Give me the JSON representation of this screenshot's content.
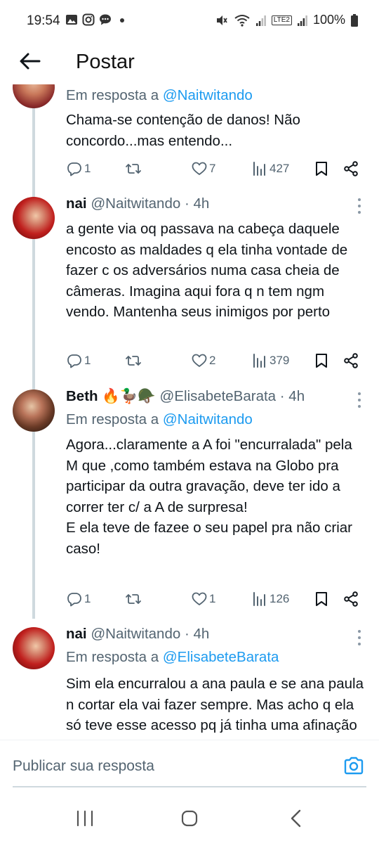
{
  "status_bar": {
    "time": "19:54",
    "battery": "100%",
    "network_label": "LTE2",
    "left_icons": [
      "gallery-icon",
      "instagram-icon",
      "chat-bubble-icon",
      "dot-icon"
    ],
    "right_icons": [
      "mute-icon",
      "wifi-icon",
      "signal-icon",
      "volte-icon",
      "signal-icon",
      "battery-icon"
    ]
  },
  "header": {
    "title": "Postar"
  },
  "posts": [
    {
      "reply_prefix": "Em resposta a",
      "reply_to": "@Naitwitando",
      "text": "Chama-se contenção de danos! Não concordo...mas entendo...",
      "replies": "1",
      "reposts": "",
      "likes": "7",
      "views": "427"
    },
    {
      "name": "nai",
      "meta": "@Naitwitando · 4h",
      "text": "a gente via oq passava na cabeça daquele encosto as maldades q ela tinha vontade de fazer c os adversários numa casa cheia de câmeras. Imagina aqui fora q n tem ngm vendo. Mantenha seus inimigos por perto",
      "replies": "1",
      "reposts": "",
      "likes": "2",
      "views": "379"
    },
    {
      "name": "Beth 🔥🦆🪖",
      "meta": "@ElisabeteBarata · 4h",
      "reply_prefix": "Em resposta a",
      "reply_to": "@Naitwitando",
      "text": "Agora...claramente a A foi \"encurralada\" pela M que ,como também estava na Globo pra participar da outra gravação, deve ter ido a correr ter c/ a A de surpresa!\nE ela teve de fazee o seu papel pra não criar caso!",
      "replies": "1",
      "reposts": "",
      "likes": "1",
      "views": "126"
    },
    {
      "name": "nai",
      "meta": "@Naitwitando · 4h",
      "reply_prefix": "Em resposta a",
      "reply_to": "@ElisabeteBarata",
      "text": "Sim ela encurralou a ana paula e se ana paula n cortar ela vai fazer sempre. Mas acho q ela só teve esse acesso pq já tinha uma afinação"
    }
  ],
  "composer": {
    "placeholder": "Publicar sua resposta"
  },
  "colors": {
    "accent": "#1d9bf0",
    "muted": "#536471",
    "thread_line": "#cfd9de"
  }
}
